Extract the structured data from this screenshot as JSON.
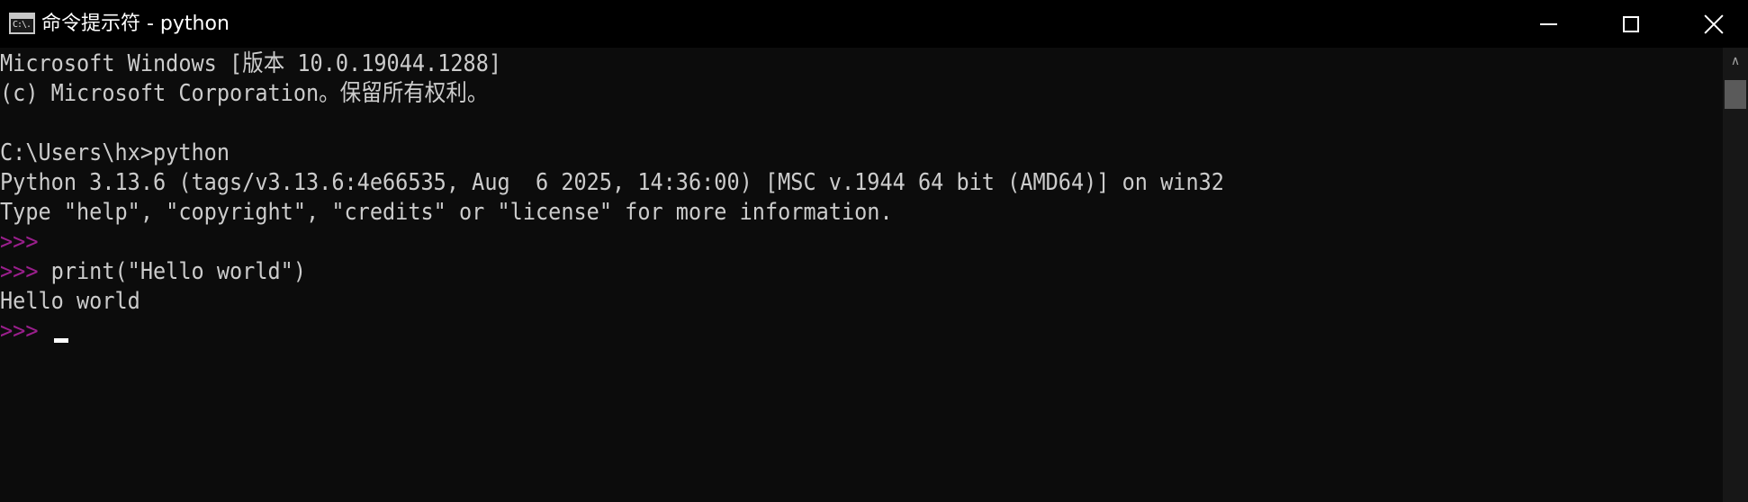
{
  "window": {
    "title": "命令提示符 - python",
    "icon": "cmd-console-icon",
    "icon_text": "C:\\."
  },
  "controls": {
    "minimize": "minimize-icon",
    "maximize": "maximize-icon",
    "close": "close-icon"
  },
  "console": {
    "lines": [
      "Microsoft Windows [版本 10.0.19044.1288]",
      "(c) Microsoft Corporation。保留所有权利。",
      "",
      "C:\\Users\\hx>python",
      "Python 3.13.6 (tags/v3.13.6:4e66535, Aug  6 2025, 14:36:00) [MSC v.1944 64 bit (AMD64)] on win32",
      "Type \"help\", \"copyright\", \"credits\" or \"license\" for more information."
    ],
    "prompt": ">>>",
    "command": " print(\"Hello world\")",
    "output": "Hello world"
  },
  "colors": {
    "background": "#0c0c0c",
    "text": "#cccccc",
    "prompt": "#9a1f8c"
  }
}
